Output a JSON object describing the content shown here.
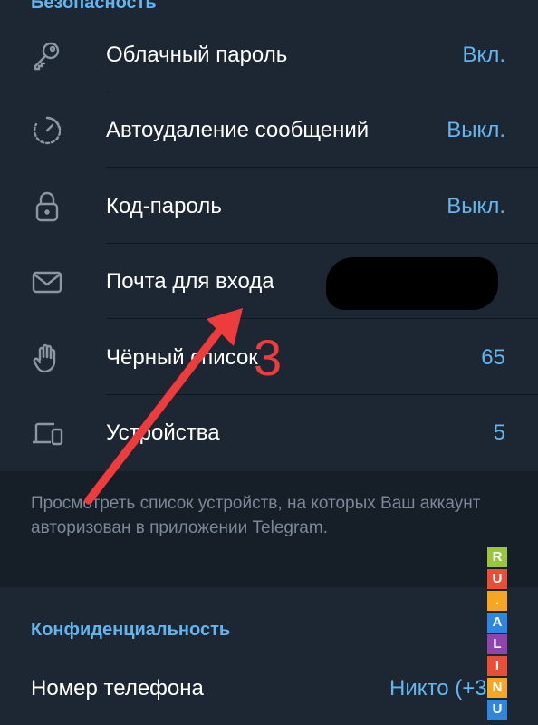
{
  "security": {
    "title": "Безопасность",
    "rows": [
      {
        "icon": "key-icon",
        "label": "Облачный пароль",
        "value": "Вкл."
      },
      {
        "icon": "timer-icon",
        "label": "Автоудаление сообщений",
        "value": "Выкл."
      },
      {
        "icon": "lock-icon",
        "label": "Код-пароль",
        "value": "Выкл."
      },
      {
        "icon": "mail-icon",
        "label": "Почта для входа",
        "value": ""
      },
      {
        "icon": "hand-icon",
        "label": "Чёрный список",
        "value": "65"
      },
      {
        "icon": "devices-icon",
        "label": "Устройства",
        "value": "5"
      }
    ],
    "info": "Просмотреть список устройств, на которых Ваш аккаунт авторизован в приложении Telegram."
  },
  "privacy": {
    "title": "Конфиденциальность",
    "phone_label": "Номер телефона",
    "phone_value": "Никто (+3"
  },
  "annotation": {
    "number": "3",
    "color": "#ee3b3b"
  },
  "watermark": {
    "letters": [
      "R",
      "U",
      ".",
      "A",
      "L",
      "I",
      "N",
      "U"
    ],
    "colors": [
      "#9bc53d",
      "#e94f37",
      "#f6a623",
      "#2e86de",
      "#8e44ad",
      "#e94f37",
      "#f6a623",
      "#2e86de"
    ]
  },
  "theme": {
    "accent": "#64b5ef",
    "background": "#1d2733",
    "info_background": "#161e28"
  }
}
